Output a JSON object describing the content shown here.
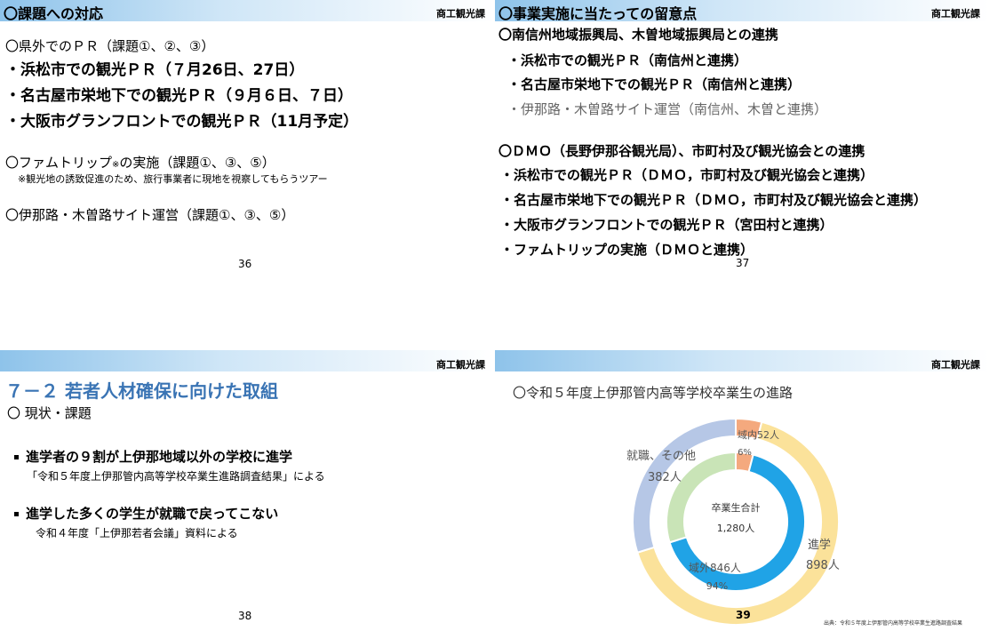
{
  "dept": "商工観光課",
  "slide36": {
    "title": "〇課題への対応",
    "pr_head": "〇県外でのＰＲ（課題①、②、③）",
    "pr_items": [
      "・浜松市での観光ＰＲ（７月26日、27日）",
      "・名古屋市栄地下での観光ＰＲ（９月６日、７日）",
      "・大阪市グランフロントでの観光ＰＲ（11月予定）"
    ],
    "fam_head": "〇ファムトリップ",
    "fam_mark": "※",
    "fam_tail": "の実施（課題①、③、⑤）",
    "fam_note": "※観光地の誘致促進のため、旅行事業者に現地を視察してもらうツアー",
    "site_head": "〇伊那路・木曽路サイト運営（課題①、③、⑤）",
    "page": "36"
  },
  "slide37": {
    "title": "〇事業実施に当たっての留意点",
    "h1": "〇南信州地域振興局、木曽地域振興局との連携",
    "h1_items": [
      "・浜松市での観光ＰＲ（南信州と連携）",
      "・名古屋市栄地下での観光ＰＲ（南信州と連携）"
    ],
    "h1_item_gray": "・伊那路・木曽路サイト運営（南信州、木曽と連携）",
    "h2": "〇ＤＭＯ（長野伊那谷観光局）、市町村及び観光協会との連携",
    "h2_items": [
      "・浜松市での観光ＰＲ（ＤＭＯ，市町村及び観光協会と連携）",
      "・名古屋市栄地下での観光ＰＲ（ＤＭＯ，市町村及び観光協会と連携）",
      "・大阪市グランフロントでの観光ＰＲ（宮田村と連携）",
      "・ファムトリップの実施（ＤＭＯと連携）"
    ],
    "page": "37"
  },
  "slide38": {
    "heading": "７－２ 若者人材確保に向けた取組",
    "sub": "〇 現状・課題",
    "b1": "進学者の９割が上伊那地域以外の学校に進学",
    "b1_note": "「令和５年度上伊那管内高等学校卒業生進路調査結果」による",
    "b2": "進学した多くの学生が就職で戻ってこない",
    "b2_note": "令和４年度「上伊那若者会議」資料による",
    "page": "38"
  },
  "slide39": {
    "title": "〇令和５年度上伊那管内高等学校卒業生の進路",
    "center_label": "卒業生合計",
    "center_value": "1,280人",
    "page": "39",
    "source": "出典：令和５年度上伊那管内高等学校卒業生進路調査結果",
    "colors": {
      "outer_shingaku": "#fbe29a",
      "outer_shushoku": "#b6c7e6",
      "outer_ikinai": "#f4a97e",
      "inner_ikigai": "#20a3e6",
      "inner_shushoku": "#c9e4b7",
      "inner_ikinai": "#f4a97e"
    }
  },
  "chart_data": {
    "type": "pie",
    "title": "〇令和５年度上伊那管内高等学校卒業生の進路",
    "total_label": "卒業生合計",
    "total": "1,280人",
    "outer": [
      {
        "label_line1": "進学",
        "label_line2": "898人",
        "value": 898
      },
      {
        "label_line1": "就職、その他",
        "label_line2": "382人",
        "value": 382
      }
    ],
    "inner": [
      {
        "label": "域外846人",
        "percent": "94%",
        "value": 846
      },
      {
        "label": "域内52人",
        "percent": "6%",
        "value": 52
      },
      {
        "label": "",
        "percent": "",
        "value": 382
      }
    ]
  }
}
